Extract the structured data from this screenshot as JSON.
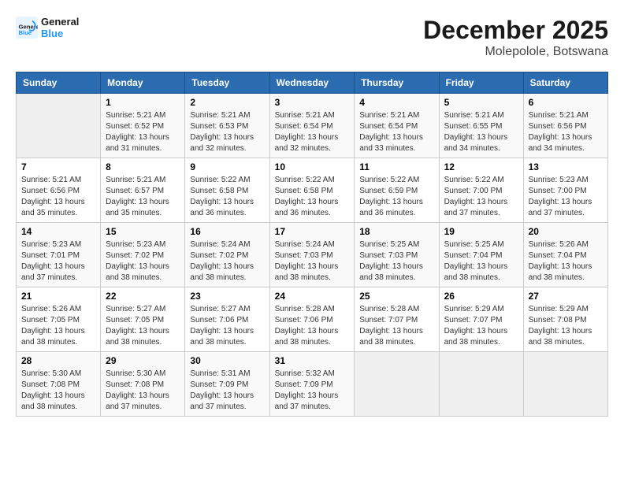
{
  "logo": {
    "line1": "General",
    "line2": "Blue"
  },
  "title": "December 2025",
  "location": "Molepolole, Botswana",
  "headers": [
    "Sunday",
    "Monday",
    "Tuesday",
    "Wednesday",
    "Thursday",
    "Friday",
    "Saturday"
  ],
  "weeks": [
    [
      {
        "day": "",
        "sunrise": "",
        "sunset": "",
        "daylight": ""
      },
      {
        "day": "1",
        "sunrise": "Sunrise: 5:21 AM",
        "sunset": "Sunset: 6:52 PM",
        "daylight": "Daylight: 13 hours and 31 minutes."
      },
      {
        "day": "2",
        "sunrise": "Sunrise: 5:21 AM",
        "sunset": "Sunset: 6:53 PM",
        "daylight": "Daylight: 13 hours and 32 minutes."
      },
      {
        "day": "3",
        "sunrise": "Sunrise: 5:21 AM",
        "sunset": "Sunset: 6:54 PM",
        "daylight": "Daylight: 13 hours and 32 minutes."
      },
      {
        "day": "4",
        "sunrise": "Sunrise: 5:21 AM",
        "sunset": "Sunset: 6:54 PM",
        "daylight": "Daylight: 13 hours and 33 minutes."
      },
      {
        "day": "5",
        "sunrise": "Sunrise: 5:21 AM",
        "sunset": "Sunset: 6:55 PM",
        "daylight": "Daylight: 13 hours and 34 minutes."
      },
      {
        "day": "6",
        "sunrise": "Sunrise: 5:21 AM",
        "sunset": "Sunset: 6:56 PM",
        "daylight": "Daylight: 13 hours and 34 minutes."
      }
    ],
    [
      {
        "day": "7",
        "sunrise": "Sunrise: 5:21 AM",
        "sunset": "Sunset: 6:56 PM",
        "daylight": "Daylight: 13 hours and 35 minutes."
      },
      {
        "day": "8",
        "sunrise": "Sunrise: 5:21 AM",
        "sunset": "Sunset: 6:57 PM",
        "daylight": "Daylight: 13 hours and 35 minutes."
      },
      {
        "day": "9",
        "sunrise": "Sunrise: 5:22 AM",
        "sunset": "Sunset: 6:58 PM",
        "daylight": "Daylight: 13 hours and 36 minutes."
      },
      {
        "day": "10",
        "sunrise": "Sunrise: 5:22 AM",
        "sunset": "Sunset: 6:58 PM",
        "daylight": "Daylight: 13 hours and 36 minutes."
      },
      {
        "day": "11",
        "sunrise": "Sunrise: 5:22 AM",
        "sunset": "Sunset: 6:59 PM",
        "daylight": "Daylight: 13 hours and 36 minutes."
      },
      {
        "day": "12",
        "sunrise": "Sunrise: 5:22 AM",
        "sunset": "Sunset: 7:00 PM",
        "daylight": "Daylight: 13 hours and 37 minutes."
      },
      {
        "day": "13",
        "sunrise": "Sunrise: 5:23 AM",
        "sunset": "Sunset: 7:00 PM",
        "daylight": "Daylight: 13 hours and 37 minutes."
      }
    ],
    [
      {
        "day": "14",
        "sunrise": "Sunrise: 5:23 AM",
        "sunset": "Sunset: 7:01 PM",
        "daylight": "Daylight: 13 hours and 37 minutes."
      },
      {
        "day": "15",
        "sunrise": "Sunrise: 5:23 AM",
        "sunset": "Sunset: 7:02 PM",
        "daylight": "Daylight: 13 hours and 38 minutes."
      },
      {
        "day": "16",
        "sunrise": "Sunrise: 5:24 AM",
        "sunset": "Sunset: 7:02 PM",
        "daylight": "Daylight: 13 hours and 38 minutes."
      },
      {
        "day": "17",
        "sunrise": "Sunrise: 5:24 AM",
        "sunset": "Sunset: 7:03 PM",
        "daylight": "Daylight: 13 hours and 38 minutes."
      },
      {
        "day": "18",
        "sunrise": "Sunrise: 5:25 AM",
        "sunset": "Sunset: 7:03 PM",
        "daylight": "Daylight: 13 hours and 38 minutes."
      },
      {
        "day": "19",
        "sunrise": "Sunrise: 5:25 AM",
        "sunset": "Sunset: 7:04 PM",
        "daylight": "Daylight: 13 hours and 38 minutes."
      },
      {
        "day": "20",
        "sunrise": "Sunrise: 5:26 AM",
        "sunset": "Sunset: 7:04 PM",
        "daylight": "Daylight: 13 hours and 38 minutes."
      }
    ],
    [
      {
        "day": "21",
        "sunrise": "Sunrise: 5:26 AM",
        "sunset": "Sunset: 7:05 PM",
        "daylight": "Daylight: 13 hours and 38 minutes."
      },
      {
        "day": "22",
        "sunrise": "Sunrise: 5:27 AM",
        "sunset": "Sunset: 7:05 PM",
        "daylight": "Daylight: 13 hours and 38 minutes."
      },
      {
        "day": "23",
        "sunrise": "Sunrise: 5:27 AM",
        "sunset": "Sunset: 7:06 PM",
        "daylight": "Daylight: 13 hours and 38 minutes."
      },
      {
        "day": "24",
        "sunrise": "Sunrise: 5:28 AM",
        "sunset": "Sunset: 7:06 PM",
        "daylight": "Daylight: 13 hours and 38 minutes."
      },
      {
        "day": "25",
        "sunrise": "Sunrise: 5:28 AM",
        "sunset": "Sunset: 7:07 PM",
        "daylight": "Daylight: 13 hours and 38 minutes."
      },
      {
        "day": "26",
        "sunrise": "Sunrise: 5:29 AM",
        "sunset": "Sunset: 7:07 PM",
        "daylight": "Daylight: 13 hours and 38 minutes."
      },
      {
        "day": "27",
        "sunrise": "Sunrise: 5:29 AM",
        "sunset": "Sunset: 7:08 PM",
        "daylight": "Daylight: 13 hours and 38 minutes."
      }
    ],
    [
      {
        "day": "28",
        "sunrise": "Sunrise: 5:30 AM",
        "sunset": "Sunset: 7:08 PM",
        "daylight": "Daylight: 13 hours and 38 minutes."
      },
      {
        "day": "29",
        "sunrise": "Sunrise: 5:30 AM",
        "sunset": "Sunset: 7:08 PM",
        "daylight": "Daylight: 13 hours and 37 minutes."
      },
      {
        "day": "30",
        "sunrise": "Sunrise: 5:31 AM",
        "sunset": "Sunset: 7:09 PM",
        "daylight": "Daylight: 13 hours and 37 minutes."
      },
      {
        "day": "31",
        "sunrise": "Sunrise: 5:32 AM",
        "sunset": "Sunset: 7:09 PM",
        "daylight": "Daylight: 13 hours and 37 minutes."
      },
      {
        "day": "",
        "sunrise": "",
        "sunset": "",
        "daylight": ""
      },
      {
        "day": "",
        "sunrise": "",
        "sunset": "",
        "daylight": ""
      },
      {
        "day": "",
        "sunrise": "",
        "sunset": "",
        "daylight": ""
      }
    ]
  ]
}
